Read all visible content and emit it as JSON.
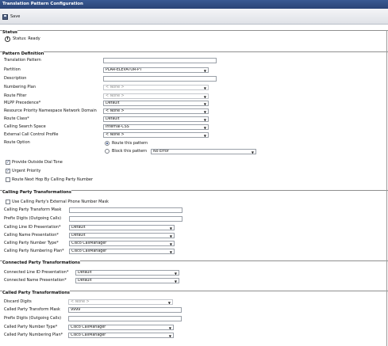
{
  "window": {
    "title": "Translation Pattern Configuration"
  },
  "toolbar": {
    "save_label": "Save"
  },
  "status": {
    "title": "Status",
    "text": "Status: Ready"
  },
  "pattern": {
    "title": "Pattern Definition",
    "translation_pattern_label": "Translation Pattern",
    "translation_pattern_value": "",
    "partition_label": "Partition",
    "partition_value": "PLAR-ELEVATOR-PT",
    "description_label": "Description",
    "description_value": "",
    "numbering_plan_label": "Numbering Plan",
    "numbering_plan_value": "< None >",
    "route_filter_label": "Route Filter",
    "route_filter_value": "< None >",
    "mlpp_label": "MLPP Precedence",
    "mlpp_value": "Default",
    "rpn_label": "Resource Priority Namespace Network Domain",
    "rpn_value": "< None >",
    "route_class_label": "Route Class",
    "route_class_value": "Default",
    "css_label": "Calling Search Space",
    "css_value": "Internal-CSS",
    "ext_call_label": "External Call Control Profile",
    "ext_call_value": "< None >",
    "route_option_label": "Route Option",
    "route_this_label": "Route this pattern",
    "block_this_label": "Block this pattern",
    "block_reason_value": "No Error",
    "outside_dial_label": "Provide Outside Dial Tone",
    "urgent_label": "Urgent Priority",
    "next_hop_label": "Route Next Hop By Calling Party Number"
  },
  "calling": {
    "title": "Calling Party Transformations",
    "use_external_label": "Use Calling Party's External Phone Number Mask",
    "transform_mask_label": "Calling Party Transform Mask",
    "transform_mask_value": "",
    "prefix_label": "Prefix Digits (Outgoing Calls)",
    "prefix_value": "",
    "line_id_label": "Calling Line ID Presentation",
    "line_id_value": "Default",
    "name_pres_label": "Calling Name Presentation",
    "name_pres_value": "Default",
    "number_type_label": "Calling Party Number Type",
    "number_type_value": "Cisco CallManager",
    "numbering_plan_label": "Calling Party Numbering Plan",
    "numbering_plan_value": "Cisco CallManager"
  },
  "connected": {
    "title": "Connected Party Transformations",
    "line_id_label": "Connected Line ID Presentation",
    "line_id_value": "Default",
    "name_label": "Connected Name Presentation",
    "name_value": "Default"
  },
  "called": {
    "title": "Called Party Transformations",
    "discard_label": "Discard Digits",
    "discard_value": "< None >",
    "transform_mask_label": "Called Party Transform Mask",
    "transform_mask_value": "9999",
    "prefix_label": "Prefix Digits (Outgoing Calls)",
    "prefix_value": "",
    "number_type_label": "Called Party Number Type",
    "number_type_value": "Cisco CallManager",
    "numbering_plan_label": "Called Party Numbering Plan",
    "numbering_plan_value": "Cisco CallManager"
  },
  "required_marker": "*"
}
